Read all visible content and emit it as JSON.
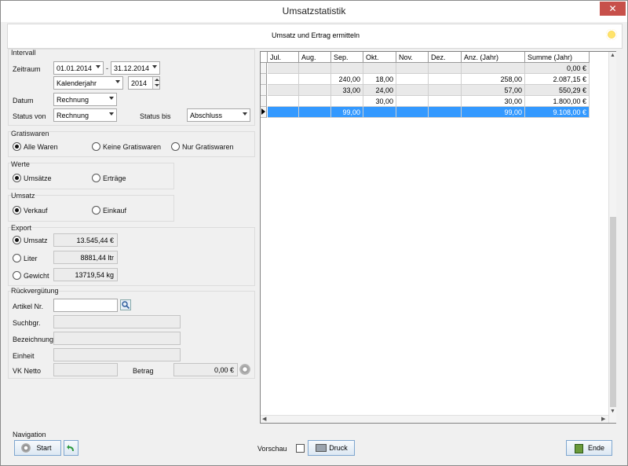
{
  "window": {
    "title": "Umsatzstatistik",
    "close": "✕"
  },
  "header": {
    "subtitle": "Umsatz und Ertrag ermitteln"
  },
  "intervall": {
    "group": "Intervall",
    "zeitraum_label": "Zeitraum",
    "date_from": "01.01.2014",
    "dash": "-",
    "date_to": "31.12.2014",
    "period_type": "Kalenderjahr",
    "year": "2014",
    "datum_label": "Datum",
    "datum_value": "Rechnung",
    "status_von_label": "Status von",
    "status_von_value": "Rechnung",
    "status_bis_label": "Status bis",
    "status_bis_value": "Abschluss"
  },
  "gratiswaren": {
    "group": "Gratiswaren",
    "opt1": "Alle Waren",
    "opt2": "Keine Gratiswaren",
    "opt3": "Nur Gratiswaren"
  },
  "werte": {
    "group": "Werte",
    "opt1": "Umsätze",
    "opt2": "Erträge"
  },
  "umsatz": {
    "group": "Umsatz",
    "opt1": "Verkauf",
    "opt2": "Einkauf"
  },
  "export": {
    "group": "Export",
    "umsatz_label": "Umsatz",
    "umsatz_value": "13.545,44 €",
    "liter_label": "Liter",
    "liter_value": "8881,44 ltr",
    "gewicht_label": "Gewicht",
    "gewicht_value": "13719,54 kg"
  },
  "rueck": {
    "group": "Rückvergütung",
    "artikel": "Artikel Nr.",
    "suchbgr": "Suchbgr.",
    "bez": "Bezeichnung",
    "einheit": "Einheit",
    "vk": "VK Netto",
    "betrag_label": "Betrag",
    "betrag_value": "0,00 €"
  },
  "table": {
    "headers": [
      "Jul.",
      "Aug.",
      "Sep.",
      "Okt.",
      "Nov.",
      "Dez.",
      "Anz. (Jahr)",
      "Summe (Jahr)"
    ],
    "rows": [
      [
        "",
        "",
        "",
        "",
        "",
        "",
        "",
        "0,00 €"
      ],
      [
        "",
        "",
        "240,00",
        "18,00",
        "",
        "",
        "258,00",
        "2.087,15 €"
      ],
      [
        "",
        "",
        "33,00",
        "24,00",
        "",
        "",
        "57,00",
        "550,29 €"
      ],
      [
        "",
        "",
        "",
        "30,00",
        "",
        "",
        "30,00",
        "1.800,00 €"
      ],
      [
        "",
        "",
        "99,00",
        "",
        "",
        "",
        "99,00",
        "9.108,00 €"
      ]
    ]
  },
  "footer": {
    "navigation": "Navigation",
    "start": "Start",
    "vorschau": "Vorschau",
    "druck": "Druck",
    "ende": "Ende"
  },
  "colors": {
    "selected_row": "#3399ff",
    "selected_text": "#ffffff"
  }
}
